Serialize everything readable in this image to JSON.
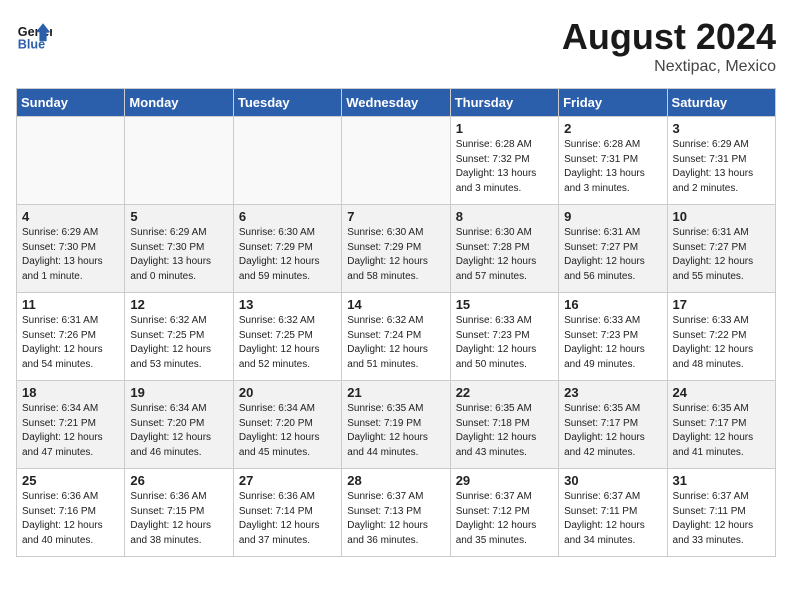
{
  "header": {
    "logo_line1": "General",
    "logo_line2": "Blue",
    "month_year": "August 2024",
    "location": "Nextipac, Mexico"
  },
  "weekdays": [
    "Sunday",
    "Monday",
    "Tuesday",
    "Wednesday",
    "Thursday",
    "Friday",
    "Saturday"
  ],
  "weeks": [
    [
      {
        "day": "",
        "info": ""
      },
      {
        "day": "",
        "info": ""
      },
      {
        "day": "",
        "info": ""
      },
      {
        "day": "",
        "info": ""
      },
      {
        "day": "1",
        "info": "Sunrise: 6:28 AM\nSunset: 7:32 PM\nDaylight: 13 hours\nand 3 minutes."
      },
      {
        "day": "2",
        "info": "Sunrise: 6:28 AM\nSunset: 7:31 PM\nDaylight: 13 hours\nand 3 minutes."
      },
      {
        "day": "3",
        "info": "Sunrise: 6:29 AM\nSunset: 7:31 PM\nDaylight: 13 hours\nand 2 minutes."
      }
    ],
    [
      {
        "day": "4",
        "info": "Sunrise: 6:29 AM\nSunset: 7:30 PM\nDaylight: 13 hours\nand 1 minute."
      },
      {
        "day": "5",
        "info": "Sunrise: 6:29 AM\nSunset: 7:30 PM\nDaylight: 13 hours\nand 0 minutes."
      },
      {
        "day": "6",
        "info": "Sunrise: 6:30 AM\nSunset: 7:29 PM\nDaylight: 12 hours\nand 59 minutes."
      },
      {
        "day": "7",
        "info": "Sunrise: 6:30 AM\nSunset: 7:29 PM\nDaylight: 12 hours\nand 58 minutes."
      },
      {
        "day": "8",
        "info": "Sunrise: 6:30 AM\nSunset: 7:28 PM\nDaylight: 12 hours\nand 57 minutes."
      },
      {
        "day": "9",
        "info": "Sunrise: 6:31 AM\nSunset: 7:27 PM\nDaylight: 12 hours\nand 56 minutes."
      },
      {
        "day": "10",
        "info": "Sunrise: 6:31 AM\nSunset: 7:27 PM\nDaylight: 12 hours\nand 55 minutes."
      }
    ],
    [
      {
        "day": "11",
        "info": "Sunrise: 6:31 AM\nSunset: 7:26 PM\nDaylight: 12 hours\nand 54 minutes."
      },
      {
        "day": "12",
        "info": "Sunrise: 6:32 AM\nSunset: 7:25 PM\nDaylight: 12 hours\nand 53 minutes."
      },
      {
        "day": "13",
        "info": "Sunrise: 6:32 AM\nSunset: 7:25 PM\nDaylight: 12 hours\nand 52 minutes."
      },
      {
        "day": "14",
        "info": "Sunrise: 6:32 AM\nSunset: 7:24 PM\nDaylight: 12 hours\nand 51 minutes."
      },
      {
        "day": "15",
        "info": "Sunrise: 6:33 AM\nSunset: 7:23 PM\nDaylight: 12 hours\nand 50 minutes."
      },
      {
        "day": "16",
        "info": "Sunrise: 6:33 AM\nSunset: 7:23 PM\nDaylight: 12 hours\nand 49 minutes."
      },
      {
        "day": "17",
        "info": "Sunrise: 6:33 AM\nSunset: 7:22 PM\nDaylight: 12 hours\nand 48 minutes."
      }
    ],
    [
      {
        "day": "18",
        "info": "Sunrise: 6:34 AM\nSunset: 7:21 PM\nDaylight: 12 hours\nand 47 minutes."
      },
      {
        "day": "19",
        "info": "Sunrise: 6:34 AM\nSunset: 7:20 PM\nDaylight: 12 hours\nand 46 minutes."
      },
      {
        "day": "20",
        "info": "Sunrise: 6:34 AM\nSunset: 7:20 PM\nDaylight: 12 hours\nand 45 minutes."
      },
      {
        "day": "21",
        "info": "Sunrise: 6:35 AM\nSunset: 7:19 PM\nDaylight: 12 hours\nand 44 minutes."
      },
      {
        "day": "22",
        "info": "Sunrise: 6:35 AM\nSunset: 7:18 PM\nDaylight: 12 hours\nand 43 minutes."
      },
      {
        "day": "23",
        "info": "Sunrise: 6:35 AM\nSunset: 7:17 PM\nDaylight: 12 hours\nand 42 minutes."
      },
      {
        "day": "24",
        "info": "Sunrise: 6:35 AM\nSunset: 7:17 PM\nDaylight: 12 hours\nand 41 minutes."
      }
    ],
    [
      {
        "day": "25",
        "info": "Sunrise: 6:36 AM\nSunset: 7:16 PM\nDaylight: 12 hours\nand 40 minutes."
      },
      {
        "day": "26",
        "info": "Sunrise: 6:36 AM\nSunset: 7:15 PM\nDaylight: 12 hours\nand 38 minutes."
      },
      {
        "day": "27",
        "info": "Sunrise: 6:36 AM\nSunset: 7:14 PM\nDaylight: 12 hours\nand 37 minutes."
      },
      {
        "day": "28",
        "info": "Sunrise: 6:37 AM\nSunset: 7:13 PM\nDaylight: 12 hours\nand 36 minutes."
      },
      {
        "day": "29",
        "info": "Sunrise: 6:37 AM\nSunset: 7:12 PM\nDaylight: 12 hours\nand 35 minutes."
      },
      {
        "day": "30",
        "info": "Sunrise: 6:37 AM\nSunset: 7:11 PM\nDaylight: 12 hours\nand 34 minutes."
      },
      {
        "day": "31",
        "info": "Sunrise: 6:37 AM\nSunset: 7:11 PM\nDaylight: 12 hours\nand 33 minutes."
      }
    ]
  ]
}
